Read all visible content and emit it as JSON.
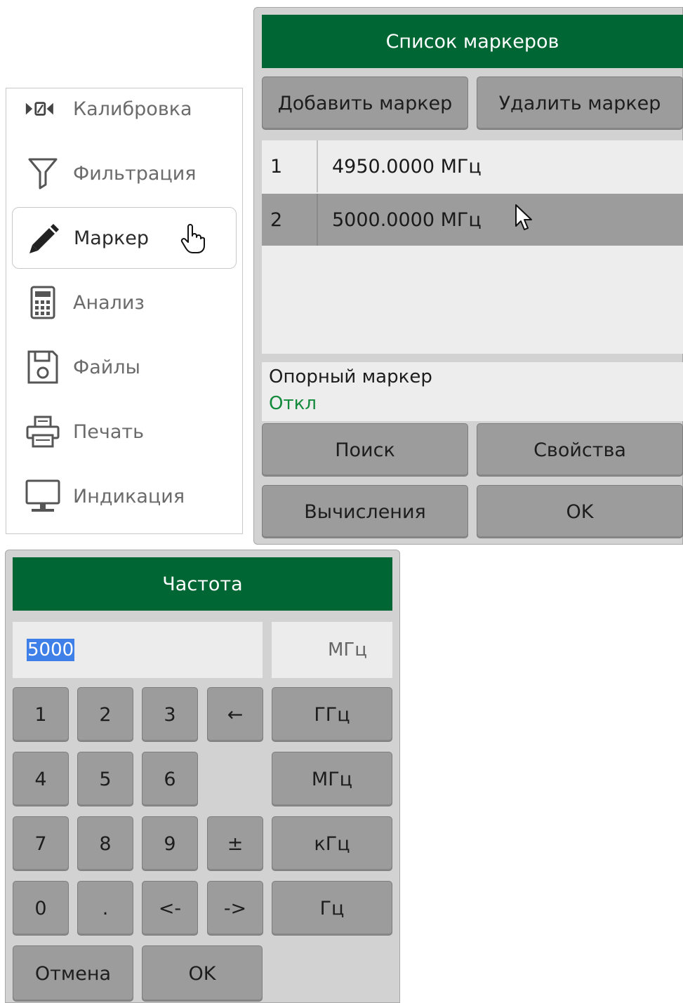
{
  "menu": {
    "items": [
      {
        "label": "Калибровка",
        "icon": "calibration-icon"
      },
      {
        "label": "Фильтрация",
        "icon": "filter-icon"
      },
      {
        "label": "Маркер",
        "icon": "pencil-icon",
        "active": true
      },
      {
        "label": "Анализ",
        "icon": "calculator-icon"
      },
      {
        "label": "Файлы",
        "icon": "floppy-disk-icon"
      },
      {
        "label": "Печать",
        "icon": "printer-icon"
      },
      {
        "label": "Индикация",
        "icon": "monitor-icon"
      }
    ]
  },
  "marker_dialog": {
    "title": "Список маркеров",
    "add_label": "Добавить маркер",
    "delete_label": "Удалить маркер",
    "markers": [
      {
        "num": "1",
        "value": "4950.0000 МГц",
        "selected": false
      },
      {
        "num": "2",
        "value": "5000.0000 МГц",
        "selected": true
      }
    ],
    "ref_label": "Опорный маркер",
    "ref_value": "Откл",
    "search_label": "Поиск",
    "properties_label": "Свойства",
    "calc_label": "Вычисления",
    "ok_label": "OK"
  },
  "freq_dialog": {
    "title": "Частота",
    "input_value": "5000",
    "unit_display": "МГц",
    "keys": {
      "k1": "1",
      "k2": "2",
      "k3": "3",
      "backspace": "←",
      "k4": "4",
      "k5": "5",
      "k6": "6",
      "k7": "7",
      "k8": "8",
      "k9": "9",
      "plusminus": "±",
      "k0": "0",
      "dot": ".",
      "left": "<-",
      "right": "->"
    },
    "units": {
      "ghz": "ГГц",
      "mhz": "МГц",
      "khz": "кГц",
      "hz": "Гц"
    },
    "cancel_label": "Отмена",
    "ok_label": "OK"
  },
  "colors": {
    "title_green": "#006633",
    "button_gray": "#9c9c9c",
    "panel_gray": "#d2d2d2",
    "status_green": "#138a3b",
    "selection_blue": "#3f7fe8"
  }
}
